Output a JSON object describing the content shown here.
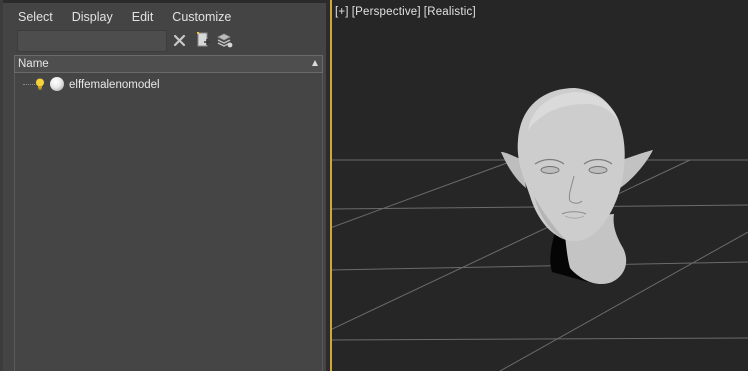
{
  "explorer": {
    "menu": {
      "select": "Select",
      "display": "Display",
      "edit": "Edit",
      "customize": "Customize"
    },
    "search": {
      "value": "",
      "placeholder": ""
    },
    "toolbar": {
      "icons": [
        "close-icon",
        "new-layer-icon",
        "layers-icon"
      ]
    },
    "columns": {
      "name": "Name"
    },
    "tree": [
      {
        "label": "elffemalenomodel",
        "icons": [
          "lightbulb-icon",
          "sphere-icon"
        ]
      }
    ]
  },
  "viewport": {
    "labels": {
      "plus": "[+]",
      "view": "[Perspective]",
      "shading": "[Realistic]"
    }
  },
  "colors": {
    "panel_bg": "#444444",
    "viewport_bg": "#262626",
    "active_viewport_border": "#d0a73a",
    "grid_line": "#6e6e6e"
  }
}
